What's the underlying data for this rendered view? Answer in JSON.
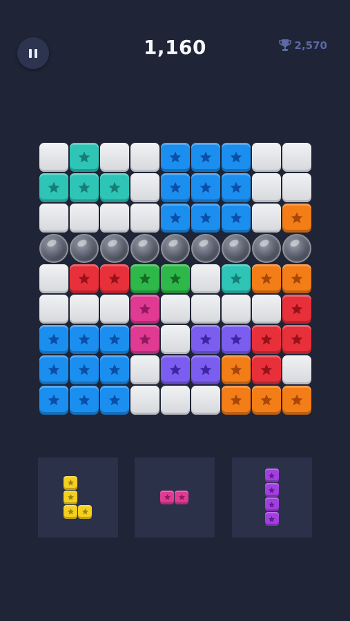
{
  "header": {
    "score": "1,160",
    "best_score": "2,570",
    "pause_icon": "pause-icon",
    "trophy_icon": "trophy-icon"
  },
  "colors": {
    "T": {
      "fill": "#2ec4b6",
      "star": "#167e78"
    },
    "B": {
      "fill": "#1b8ff0",
      "star": "#0c4fa8"
    },
    "O": {
      "fill": "#f37d16",
      "star": "#a8470a"
    },
    "R": {
      "fill": "#e8303a",
      "star": "#97121a"
    },
    "G": {
      "fill": "#2fb84a",
      "star": "#136b24"
    },
    "M": {
      "fill": "#e03a93",
      "star": "#921a5c"
    },
    "P": {
      "fill": "#7b5ef0",
      "star": "#3d25a8"
    },
    "Y": {
      "fill": "#f3cf1f",
      "star": "#9e8208"
    },
    "V": {
      "fill": "#a23fdf",
      "star": "#611c92"
    }
  },
  "board": {
    "rows": [
      [
        "E",
        "T",
        "E",
        "E",
        "B",
        "B",
        "B",
        "E",
        "E"
      ],
      [
        "T",
        "T",
        "T",
        "E",
        "B",
        "B",
        "B",
        "E",
        "E"
      ],
      [
        "E",
        "E",
        "E",
        "E",
        "B",
        "B",
        "B",
        "E",
        "O"
      ],
      [
        "X",
        "X",
        "X",
        "X",
        "X",
        "X",
        "X",
        "X",
        "X"
      ],
      [
        "E",
        "R",
        "R",
        "G",
        "G",
        "E",
        "T",
        "O",
        "O"
      ],
      [
        "E",
        "E",
        "E",
        "M",
        "E",
        "E",
        "E",
        "E",
        "R"
      ],
      [
        "B",
        "B",
        "B",
        "M",
        "E",
        "P",
        "P",
        "R",
        "R"
      ],
      [
        "B",
        "B",
        "B",
        "E",
        "P",
        "P",
        "O",
        "R",
        "E"
      ],
      [
        "B",
        "B",
        "B",
        "E",
        "E",
        "E",
        "O",
        "O",
        "O"
      ]
    ]
  },
  "tray": [
    {
      "color": "Y",
      "cells": [
        [
          0,
          0
        ],
        [
          0,
          1
        ],
        [
          0,
          2
        ],
        [
          1,
          2
        ]
      ]
    },
    {
      "color": "M",
      "cells": [
        [
          0,
          0
        ],
        [
          1,
          0
        ]
      ]
    },
    {
      "color": "V",
      "cells": [
        [
          0,
          0
        ],
        [
          0,
          1
        ],
        [
          0,
          2
        ],
        [
          0,
          3
        ]
      ]
    }
  ]
}
